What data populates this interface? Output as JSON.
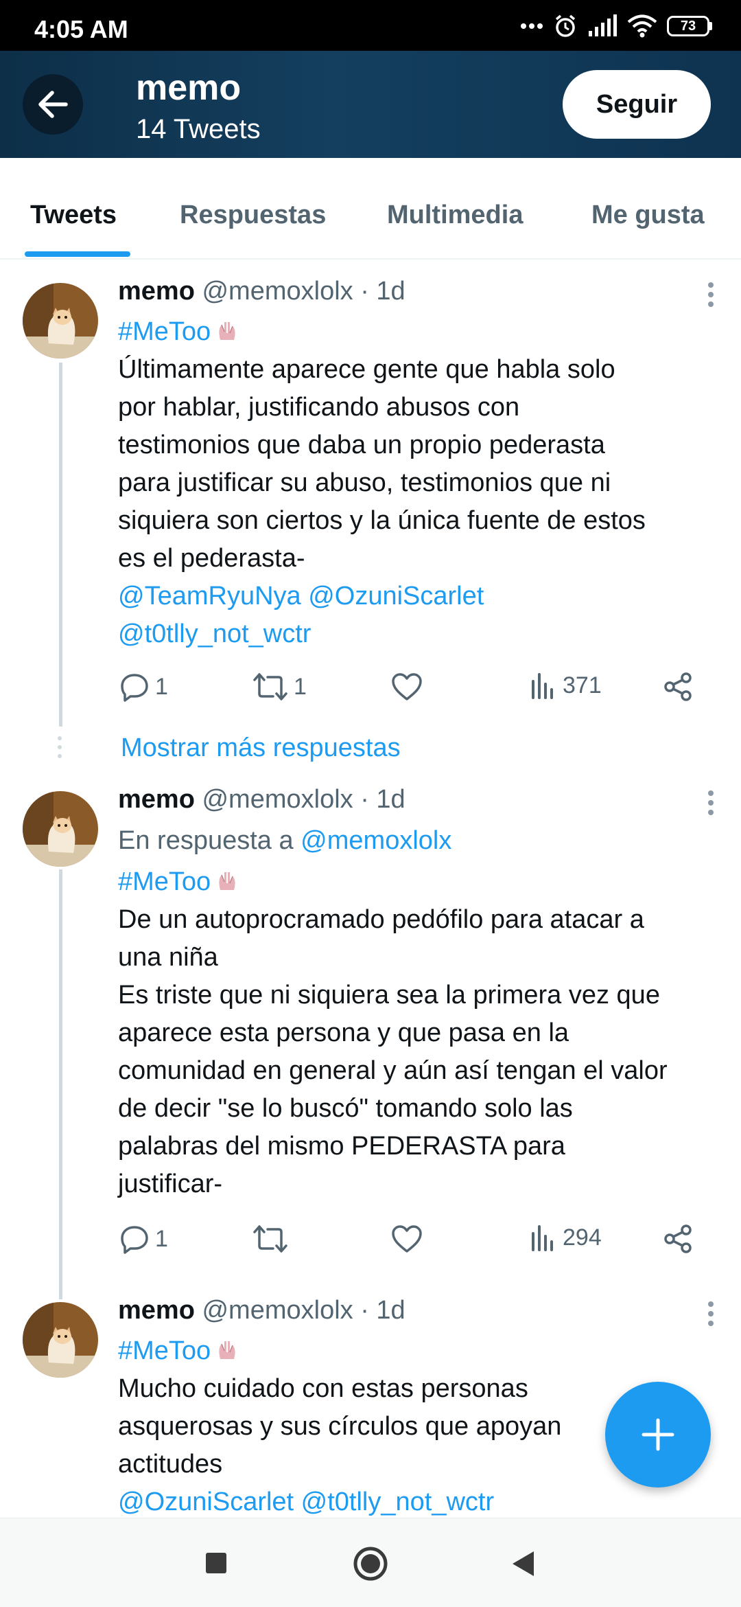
{
  "status_bar": {
    "time": "4:05 AM",
    "battery": "73"
  },
  "header": {
    "name": "memo",
    "tweet_count": "14 Tweets",
    "follow_label": "Seguir"
  },
  "tabs": [
    "Tweets",
    "Respuestas",
    "Multimedia",
    "Me gusta"
  ],
  "tweets": [
    {
      "name": "memo",
      "meta": "@memoxlolx · 1d",
      "hashtag": "#MeToo",
      "lines": [
        "Últimamente aparece gente que habla solo",
        "por hablar, justificando abusos con",
        "testimonios que daba un propio pederasta",
        "para justificar su abuso, testimonios que ni",
        "siquiera son ciertos y la única fuente de estos",
        "es el pederasta-"
      ],
      "mentions": [
        "@TeamRyuNya @OzuniScarlet",
        "@t0tlly_not_wctr"
      ],
      "replies": "1",
      "retweets": "1",
      "views": "371"
    },
    {
      "name": "memo",
      "meta": "@memoxlolx · 1d",
      "reply_prefix": "En respuesta a",
      "reply_to": "@memoxlolx",
      "hashtag": "#MeToo",
      "lines": [
        "De un autoprocramado pedófilo para atacar a",
        "una niña",
        "Es triste que ni siquiera sea la primera vez que",
        "aparece esta persona y que pasa en la",
        "comunidad en general y aún así tengan el valor",
        "de decir \"se lo buscó\" tomando solo las",
        "palabras del mismo PEDERASTA para",
        "justificar-"
      ],
      "replies": "1",
      "views": "294"
    },
    {
      "name": "memo",
      "meta": "@memoxlolx · 1d",
      "hashtag": "#MeToo",
      "lines": [
        "Mucho cuidado con estas personas",
        "asquerosas y sus círculos que apoyan",
        "actitudes"
      ],
      "mentions": [
        "@OzuniScarlet @t0tlly_not_wctr"
      ]
    }
  ],
  "show_more": "Mostrar más respuestas",
  "icons": {
    "back": "arrow-left-icon",
    "more": "more-vertical-icon",
    "reply": "reply-icon",
    "retweet": "retweet-icon",
    "like": "heart-icon",
    "views": "views-icon",
    "share": "share-icon",
    "compose": "plus-icon"
  },
  "colors": {
    "accent": "#1d9bf0",
    "header_bg": "#123a58",
    "text_secondary": "#536471"
  }
}
